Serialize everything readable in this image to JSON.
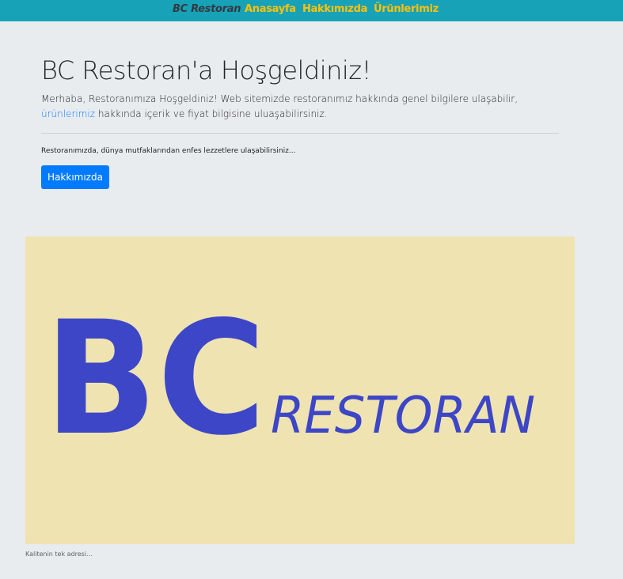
{
  "navbar": {
    "brand": "BC Restoran",
    "links": [
      {
        "label": "Anasayfa"
      },
      {
        "label": "Hakkımızda"
      },
      {
        "label": "Ürünlerimiz"
      }
    ]
  },
  "jumbotron": {
    "title": "BC Restoran'a Hoşgeldiniz!",
    "lead_before": "Merhaba, Restoranımıza Hoşgeldiniz! Web sitemizde restoranımız hakkında genel bilgilere ulaşabilir, ",
    "lead_link": "ürünlerimiz",
    "lead_after": " hakkında içerik ve fiyat bilgisine uluaşabilirsiniz.",
    "sub_text": "Restoranımızda, dünya mutfaklarından enfes lezzetlere ulaşabilirsiniz...",
    "button_label": "Hakkımızda"
  },
  "logo": {
    "big_text": "BC",
    "small_text": "RESTORAN",
    "color": "#3d46c7",
    "background": "#efe3b1"
  },
  "caption": "Kalitenin tek adresi..."
}
